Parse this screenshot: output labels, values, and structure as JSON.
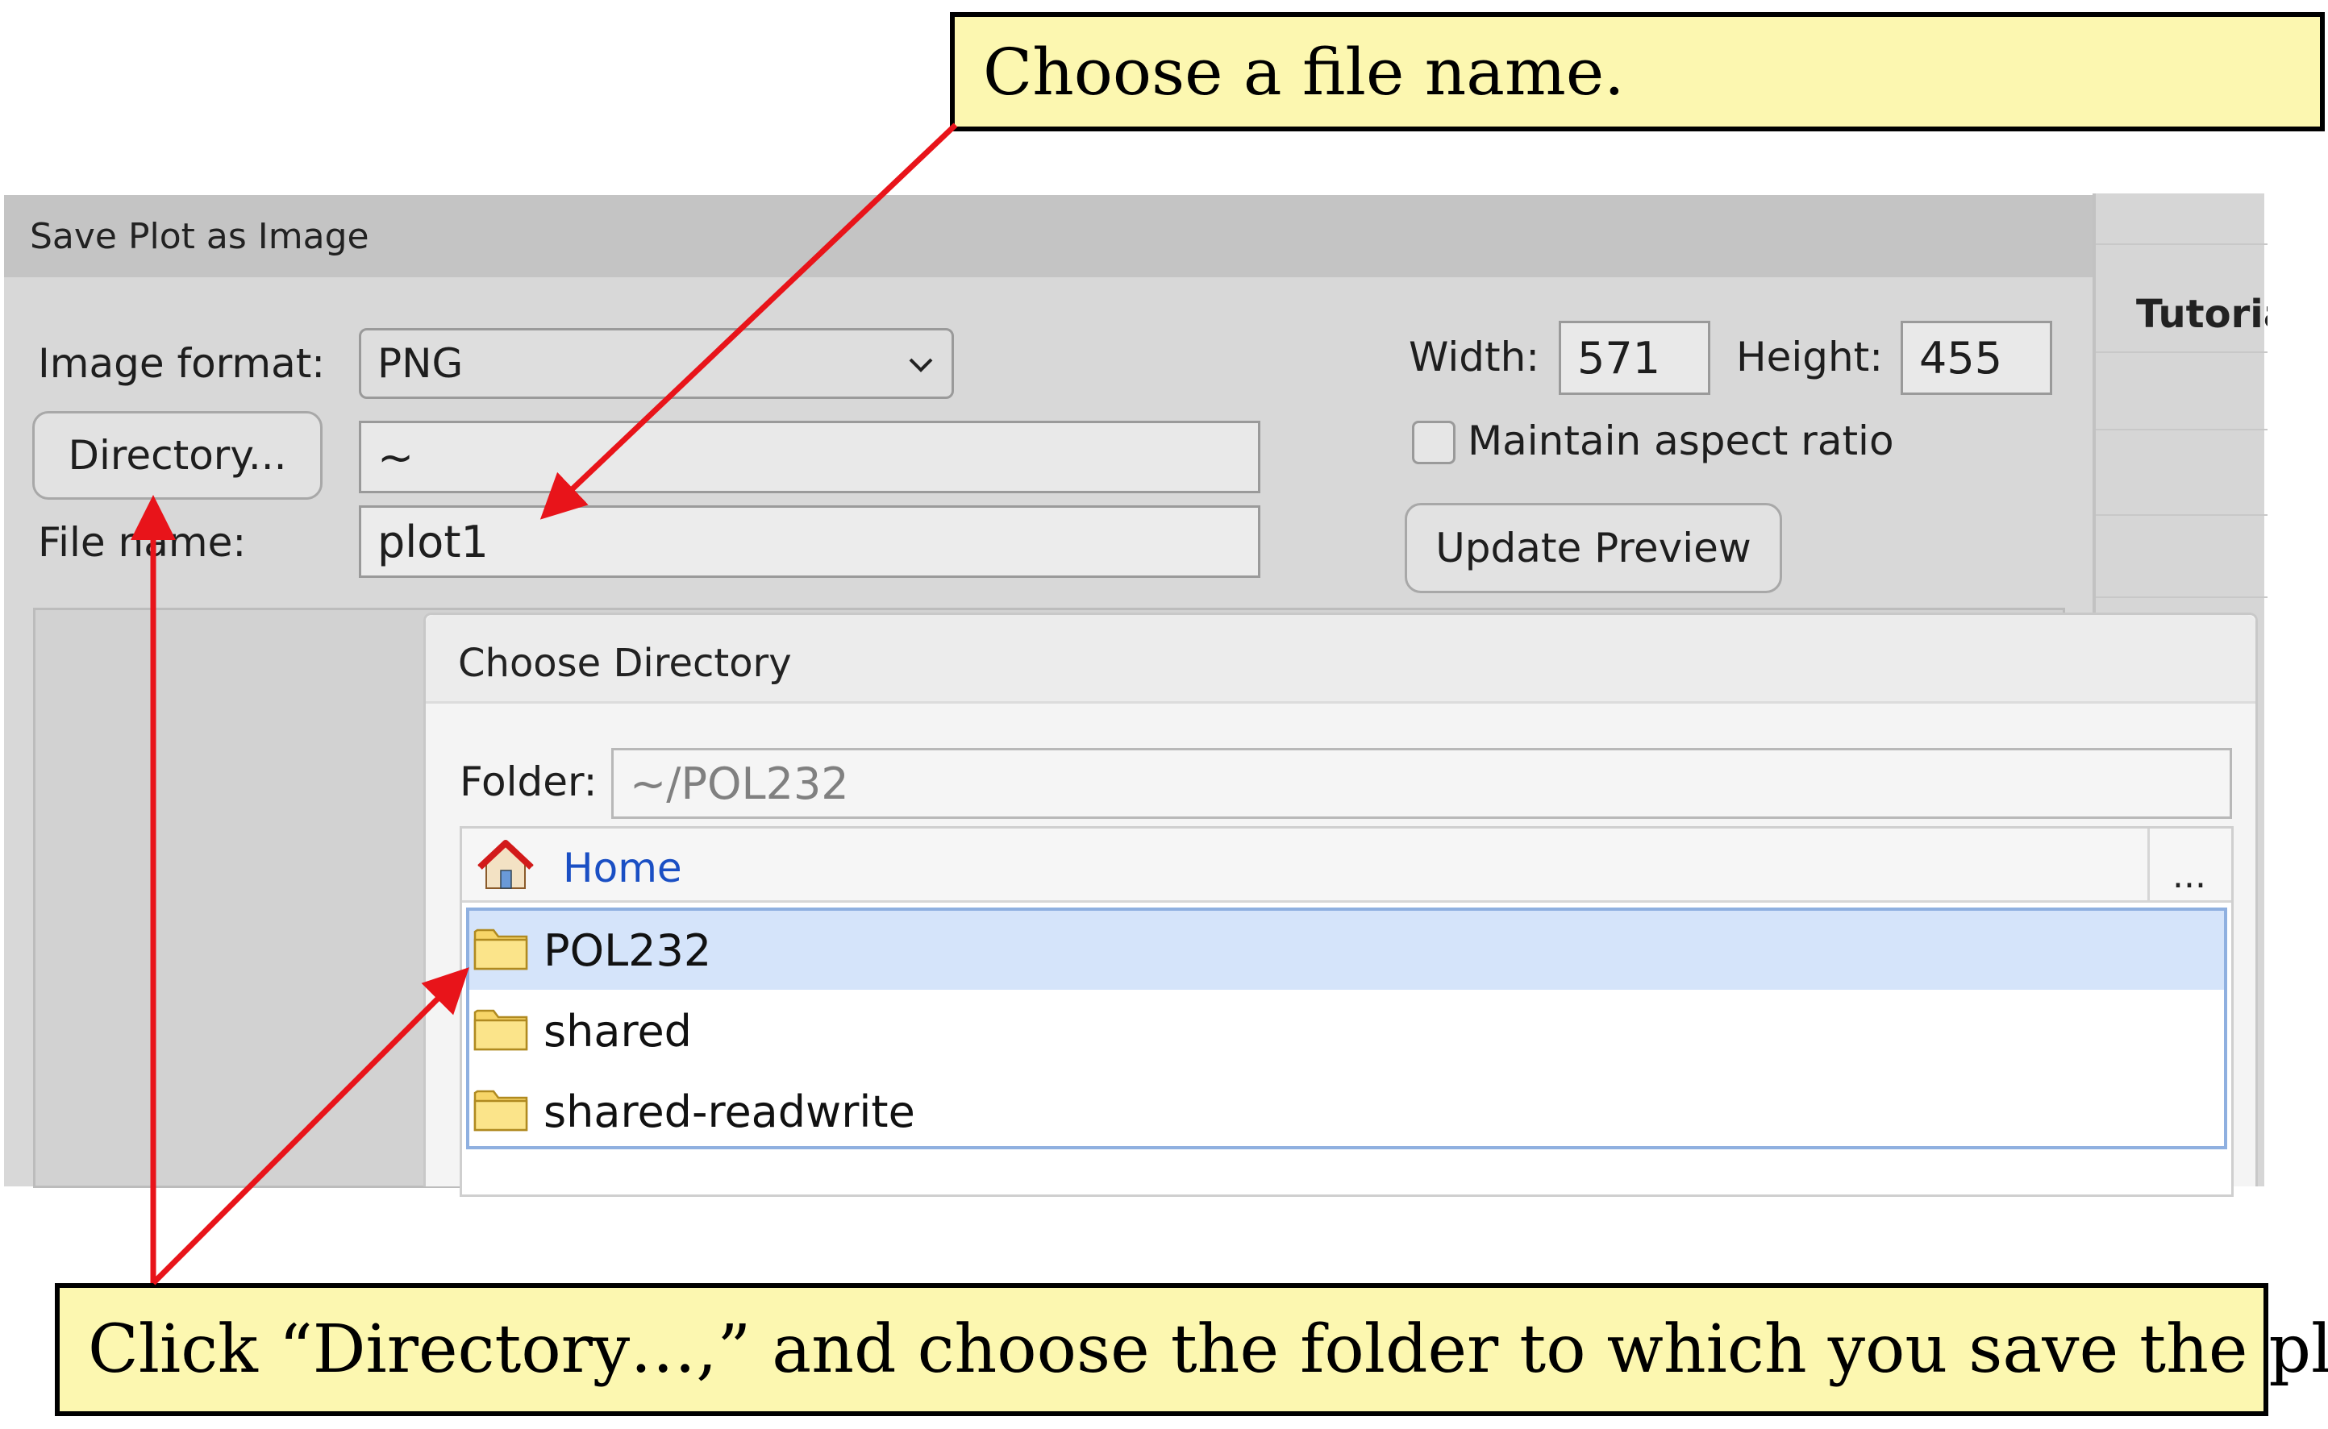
{
  "save_dialog": {
    "title": "Save Plot as Image",
    "image_format_label": "Image format:",
    "image_format_value": "PNG",
    "directory_button": "Directory...",
    "directory_value": "~",
    "file_name_label": "File name:",
    "file_name_value": "plot1",
    "width_label": "Width:",
    "width_value": "571",
    "height_label": "Height:",
    "height_value": "455",
    "maintain_aspect_label": "Maintain aspect ratio",
    "maintain_aspect_checked": false,
    "update_preview_button": "Update Preview"
  },
  "side_panel": {
    "tab_label": "Tutorial"
  },
  "choose_directory": {
    "title": "Choose Directory",
    "folder_label": "Folder:",
    "folder_value": "~/POL232",
    "home_link": "Home",
    "more_button": "...",
    "items": [
      {
        "name": "POL232",
        "selected": true
      },
      {
        "name": "shared",
        "selected": false
      },
      {
        "name": "shared-readwrite",
        "selected": false
      }
    ]
  },
  "annotations": {
    "top": "Choose a file name.",
    "bottom": "Click “Directory…,” and choose the folder to which you save the plot."
  },
  "colors": {
    "callout_fill": "#fcf7b0",
    "arrow": "#e8141a",
    "link": "#1a4fc4",
    "selection": "#d5e4fa"
  }
}
